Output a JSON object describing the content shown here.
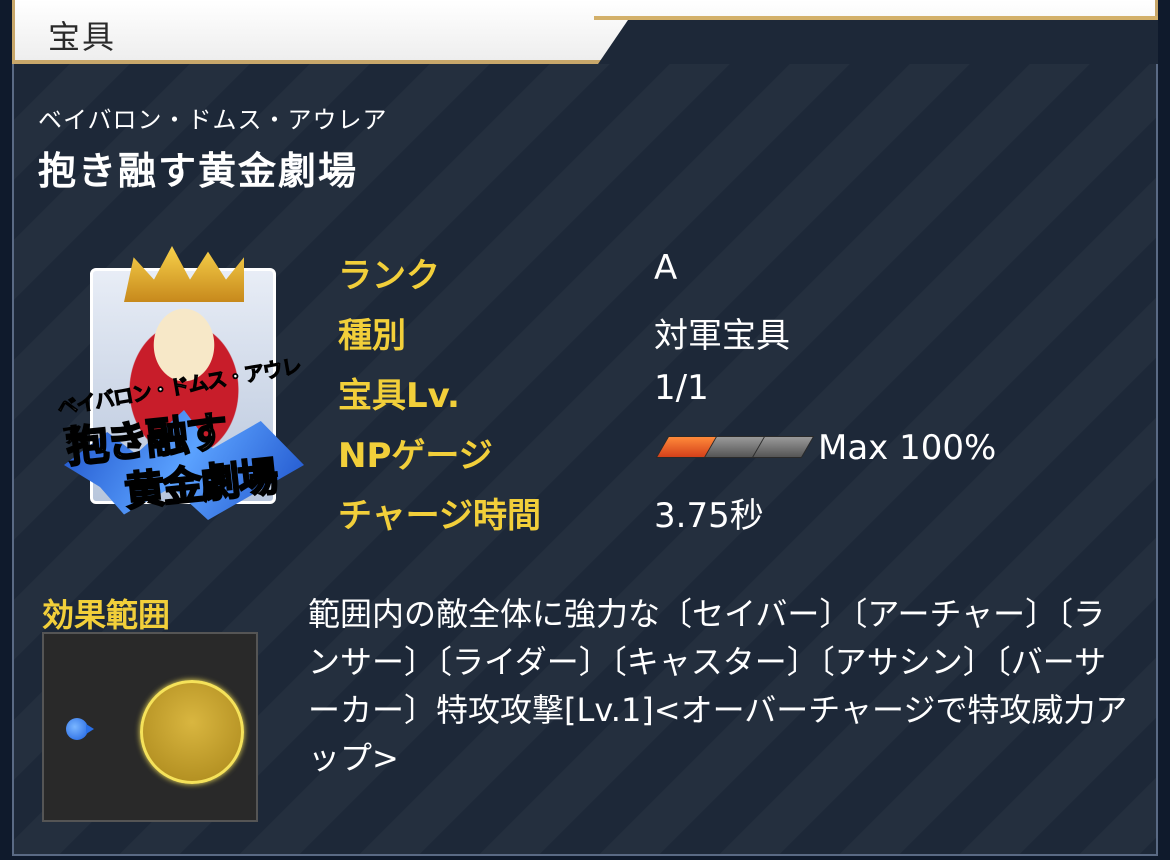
{
  "header": {
    "title": "宝具"
  },
  "noble_phantasm": {
    "ruby": "ベイバロン・ドムス・アウレア",
    "name": "抱き融す黄金劇場",
    "card": {
      "ruby": "ベイバロン・ドムス・アウレア",
      "line1": "抱き融す",
      "line2": "黄金劇場"
    }
  },
  "stats": {
    "rank_label": "ランク",
    "rank_value": "A",
    "type_label": "種別",
    "type_value": "対軍宝具",
    "level_label": "宝具Lv.",
    "level_value": "1/1",
    "np_label": "NPゲージ",
    "np_gauge_filled": 1,
    "np_gauge_total": 3,
    "np_value": "Max 100%",
    "charge_label": "チャージ時間",
    "charge_value": "3.75秒"
  },
  "range": {
    "label": "効果範囲"
  },
  "effect": {
    "text": "範囲内の敵全体に強力な〔セイバー〕〔アーチャー〕〔ランサー〕〔ライダー〕〔キャスター〕〔アサシン〕〔バーサーカー〕特攻攻撃[Lv.1]<オーバーチャージで特攻威力アップ>"
  },
  "colors": {
    "accent_gold": "#f2cf3a",
    "panel_bg": "#1d2838",
    "gauge_fill": "#e45a22"
  }
}
